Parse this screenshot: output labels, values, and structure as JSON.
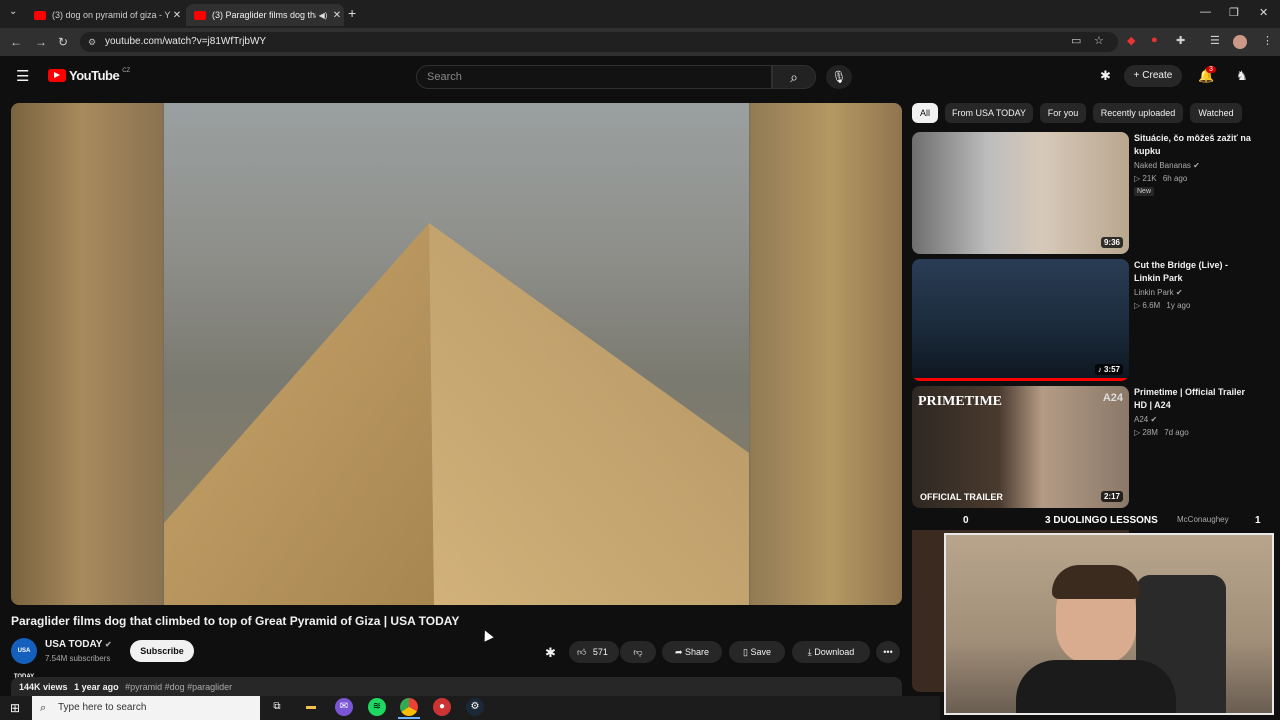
{
  "browser": {
    "tabs": [
      {
        "title": "(3) dog on pyramid of giza - You",
        "active": false
      },
      {
        "title": "(3) Paraglider films dog that",
        "active": true
      }
    ],
    "new_tab": "+",
    "url": "youtube.com/watch?v=j81WfTrjbWY"
  },
  "youtube": {
    "logo": "YouTube",
    "country": "CZ",
    "search_placeholder": "Search",
    "create_label": "Create",
    "notifications_count": "3"
  },
  "video": {
    "title": "Paraglider films dog that climbed to top of Great Pyramid of Giza | USA TODAY",
    "channel": {
      "name": "USA TODAY",
      "avatar_text": "USA TODAY",
      "subscribers": "7.54M subscribers",
      "subscribe_label": "Subscribe"
    },
    "likes": "571",
    "share_label": "Share",
    "save_label": "Save",
    "download_label": "Download",
    "views": "144K views",
    "age": "1 year ago",
    "tags": "#pyramid #dog #paraglider"
  },
  "chips": [
    "All",
    "From USA TODAY",
    "For you",
    "Recently uploaded",
    "Watched"
  ],
  "recommendations": [
    {
      "title": "Situácie, čo môžeš zažiť na kupku",
      "channel": "Naked Bananas",
      "views": "21K",
      "age": "6h ago",
      "duration": "9:36",
      "badge": "New"
    },
    {
      "title": "Cut the Bridge (Live) - Linkin Park",
      "channel": "Linkin Park",
      "views": "6.6M",
      "age": "1y ago",
      "duration": "3:57"
    },
    {
      "title": "Primetime | Official Trailer HD | A24",
      "channel": "A24",
      "views": "28M",
      "age": "7d ago",
      "duration": "2:17",
      "thumb_text": "OFFICIAL TRAILER",
      "thumb_brand": "PRIMETIME",
      "thumb_brand2": "A24"
    }
  ],
  "overlay": {
    "left_count": "0",
    "text": "3 DUOLINGO LESSONS",
    "right_count": "1",
    "behind_text": "McConaughey"
  },
  "taskbar": {
    "search_placeholder": "Type here to search"
  }
}
